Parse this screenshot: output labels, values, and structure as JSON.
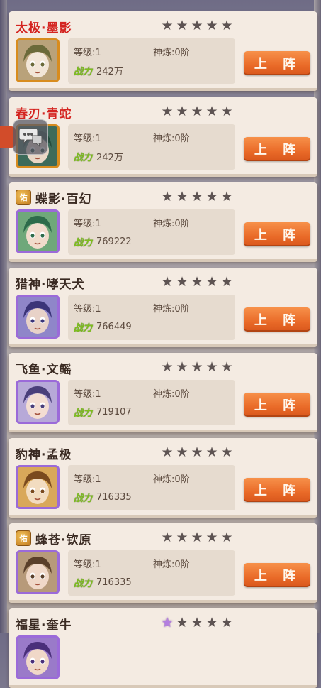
{
  "labels": {
    "level_prefix": "等级:",
    "forge_prefix": "神炼:",
    "power_label": "战力",
    "deploy_button": "上 阵",
    "blessed_badge": "佑"
  },
  "colors": {
    "name_red": "#d42420",
    "name_dark": "#3a2a22",
    "button_orange": "#e96a28",
    "star_dark": "#5d5352",
    "star_purple": "#b37ee0"
  },
  "icons": {
    "chat": "chat-bubble-icon",
    "star": "star-icon"
  },
  "heroes": [
    {
      "name": "太极·墨影",
      "name_style": "red",
      "blessed": false,
      "level": "1",
      "forge": "0阶",
      "power": "242万",
      "stars": 5,
      "purple_star": false,
      "frame": "gold"
    },
    {
      "name": "春刃·青蛇",
      "name_style": "red",
      "blessed": false,
      "level": "1",
      "forge": "0阶",
      "power": "242万",
      "stars": 5,
      "purple_star": false,
      "frame": "gold"
    },
    {
      "name": "蝶影·百幻",
      "name_style": "dark",
      "blessed": true,
      "level": "1",
      "forge": "0阶",
      "power": "769222",
      "stars": 5,
      "purple_star": false,
      "frame": "purple"
    },
    {
      "name": "猎神·哮天犬",
      "name_style": "dark",
      "blessed": false,
      "level": "1",
      "forge": "0阶",
      "power": "766449",
      "stars": 5,
      "purple_star": false,
      "frame": "purple"
    },
    {
      "name": "飞鱼·文鳐",
      "name_style": "dark",
      "blessed": false,
      "level": "1",
      "forge": "0阶",
      "power": "719107",
      "stars": 5,
      "purple_star": false,
      "frame": "purple"
    },
    {
      "name": "豹神·孟极",
      "name_style": "dark",
      "blessed": false,
      "level": "1",
      "forge": "0阶",
      "power": "716335",
      "stars": 5,
      "purple_star": false,
      "frame": "purple"
    },
    {
      "name": "蜂苍·钦原",
      "name_style": "dark",
      "blessed": true,
      "level": "1",
      "forge": "0阶",
      "power": "716335",
      "stars": 5,
      "purple_star": false,
      "frame": "purple"
    },
    {
      "name": "福星·奎牛",
      "name_style": "dark",
      "blessed": false,
      "level": "",
      "forge": "",
      "power": "",
      "stars": 5,
      "purple_star": true,
      "frame": "purple"
    }
  ]
}
